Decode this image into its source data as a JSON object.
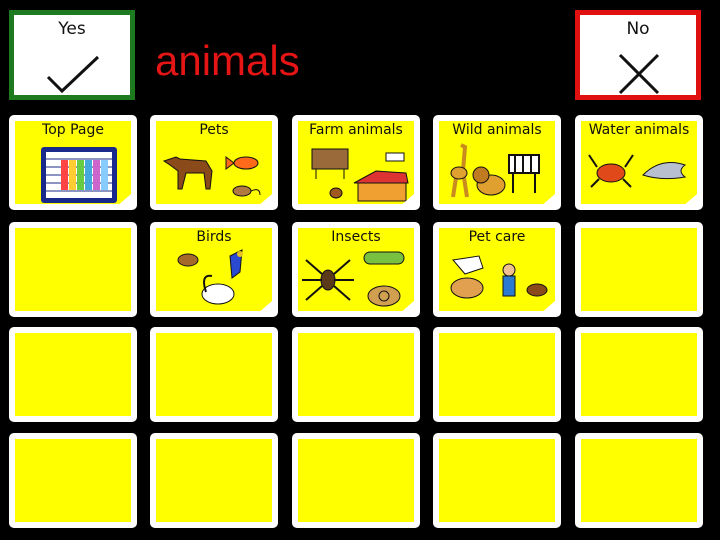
{
  "header": {
    "title": "animals"
  },
  "yes_button": {
    "label": "Yes",
    "icon": "check-icon",
    "border_color": "#1e7a1e"
  },
  "no_button": {
    "label": "No",
    "icon": "cross-icon",
    "border_color": "#e01010"
  },
  "grid": {
    "cell_color": "#ffff00",
    "rows": [
      [
        {
          "label": "Top Page",
          "icon": "grid-chart-icon"
        },
        {
          "label": "Pets",
          "icon": "pets-icon"
        },
        {
          "label": "Farm animals",
          "icon": "farm-animals-icon"
        },
        {
          "label": "Wild animals",
          "icon": "wild-animals-icon"
        },
        {
          "label": "Water animals",
          "icon": "water-animals-icon"
        }
      ],
      [
        {
          "label": "",
          "icon": ""
        },
        {
          "label": "Birds",
          "icon": "birds-icon"
        },
        {
          "label": "Insects",
          "icon": "insects-icon"
        },
        {
          "label": "Pet care",
          "icon": "pet-care-icon"
        },
        {
          "label": "",
          "icon": ""
        }
      ],
      [
        {
          "label": "",
          "icon": ""
        },
        {
          "label": "",
          "icon": ""
        },
        {
          "label": "",
          "icon": ""
        },
        {
          "label": "",
          "icon": ""
        },
        {
          "label": "",
          "icon": ""
        }
      ],
      [
        {
          "label": "",
          "icon": ""
        },
        {
          "label": "",
          "icon": ""
        },
        {
          "label": "",
          "icon": ""
        },
        {
          "label": "",
          "icon": ""
        },
        {
          "label": "",
          "icon": ""
        }
      ]
    ]
  }
}
